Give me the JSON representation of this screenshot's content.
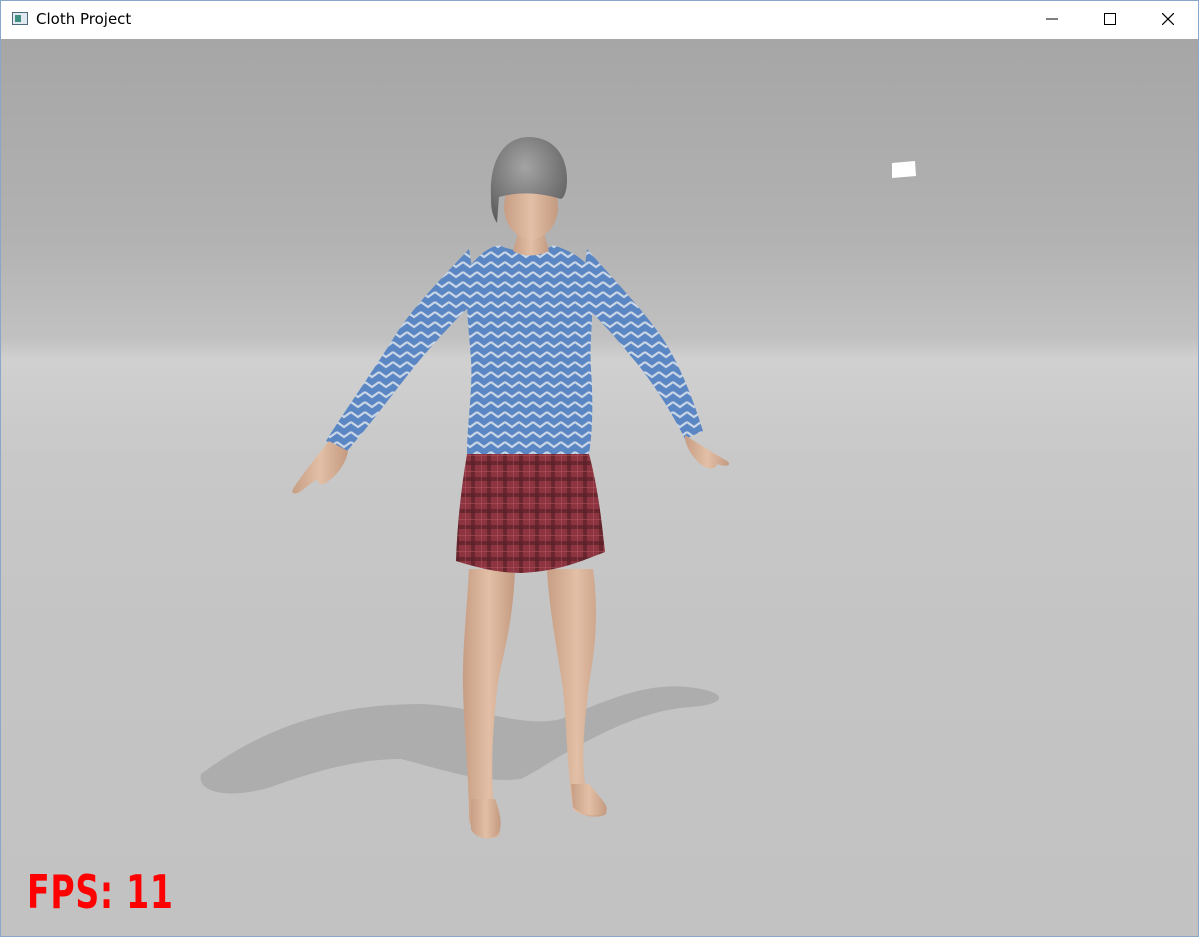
{
  "window": {
    "title": "Cloth Project",
    "controls": [
      "minimize",
      "maximize",
      "close"
    ]
  },
  "viewport": {
    "icons": {
      "app": "app-window-icon",
      "minimize": "minimize-icon",
      "maximize": "maximize-icon",
      "close": "close-icon"
    },
    "fps_label": "FPS:",
    "fps_value": 11,
    "fps_text": "FPS: 11"
  },
  "colors": {
    "fps": "#ff0000",
    "shirt": "#5b86c4",
    "skirt": "#8c3440",
    "skin": "#d9b49a",
    "hair": "#7a7a7a"
  }
}
